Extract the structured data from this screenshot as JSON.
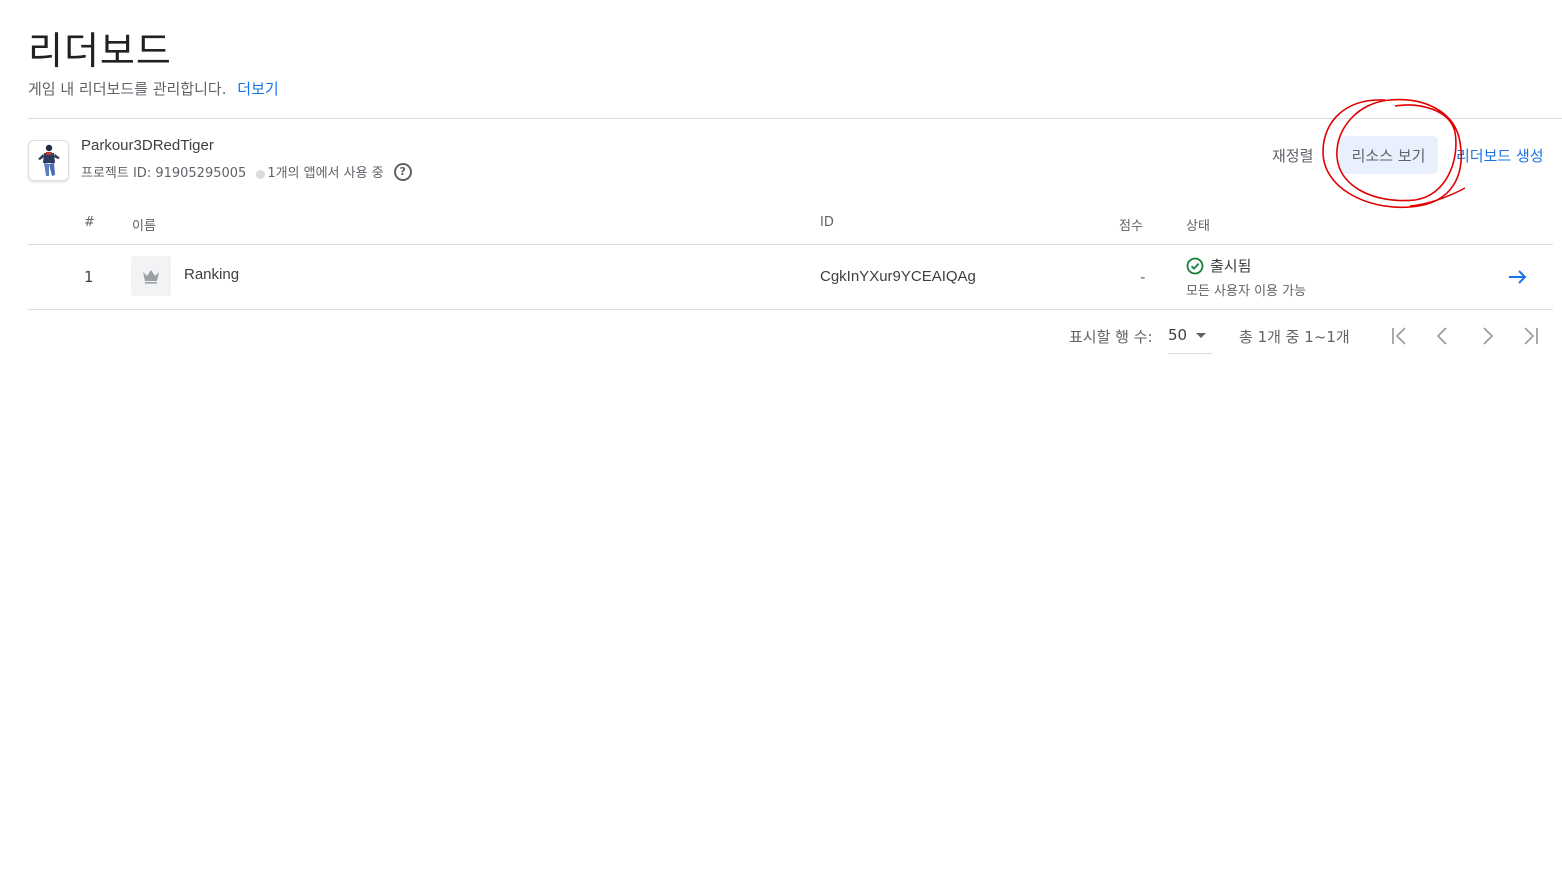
{
  "page": {
    "title": "리더보드",
    "subtitle": "게임 내 리더보드를 관리합니다.",
    "learn_more": "더보기"
  },
  "project": {
    "name": "Parkour3DRedTiger",
    "id_text": "프로젝트 ID: 91905295005",
    "apps_text": "1개의 앱에서 사용 중",
    "help_glyph": "?"
  },
  "actions": {
    "reorder": "재정렬",
    "view_resources": "리소스 보기",
    "create": "리더보드 생성"
  },
  "table": {
    "headers": {
      "index": "#",
      "name": "이름",
      "id": "ID",
      "score": "점수",
      "status": "상태"
    },
    "rows": [
      {
        "index": "1",
        "name": "Ranking",
        "id": "CgkInYXur9YCEAIQAg",
        "score": "-",
        "status": "출시됨",
        "status_detail": "모든 사용자 이용 가능"
      }
    ]
  },
  "pagination": {
    "rows_label": "표시할 행 수:",
    "rows_value": "50",
    "range_text": "총 1개 중 1~1개"
  },
  "colors": {
    "accent": "#1a73e8",
    "success": "#188038",
    "annotation": "#e00000",
    "highlight_bg": "#e8f0fe"
  },
  "icons": {
    "app": "runner-avatar-icon",
    "help": "help-circle-icon",
    "row_image": "crown-icon",
    "status": "check-circle-icon",
    "open": "arrow-right-icon",
    "first": "first-page-icon",
    "prev": "chevron-left-icon",
    "next": "chevron-right-icon",
    "last": "last-page-icon"
  }
}
